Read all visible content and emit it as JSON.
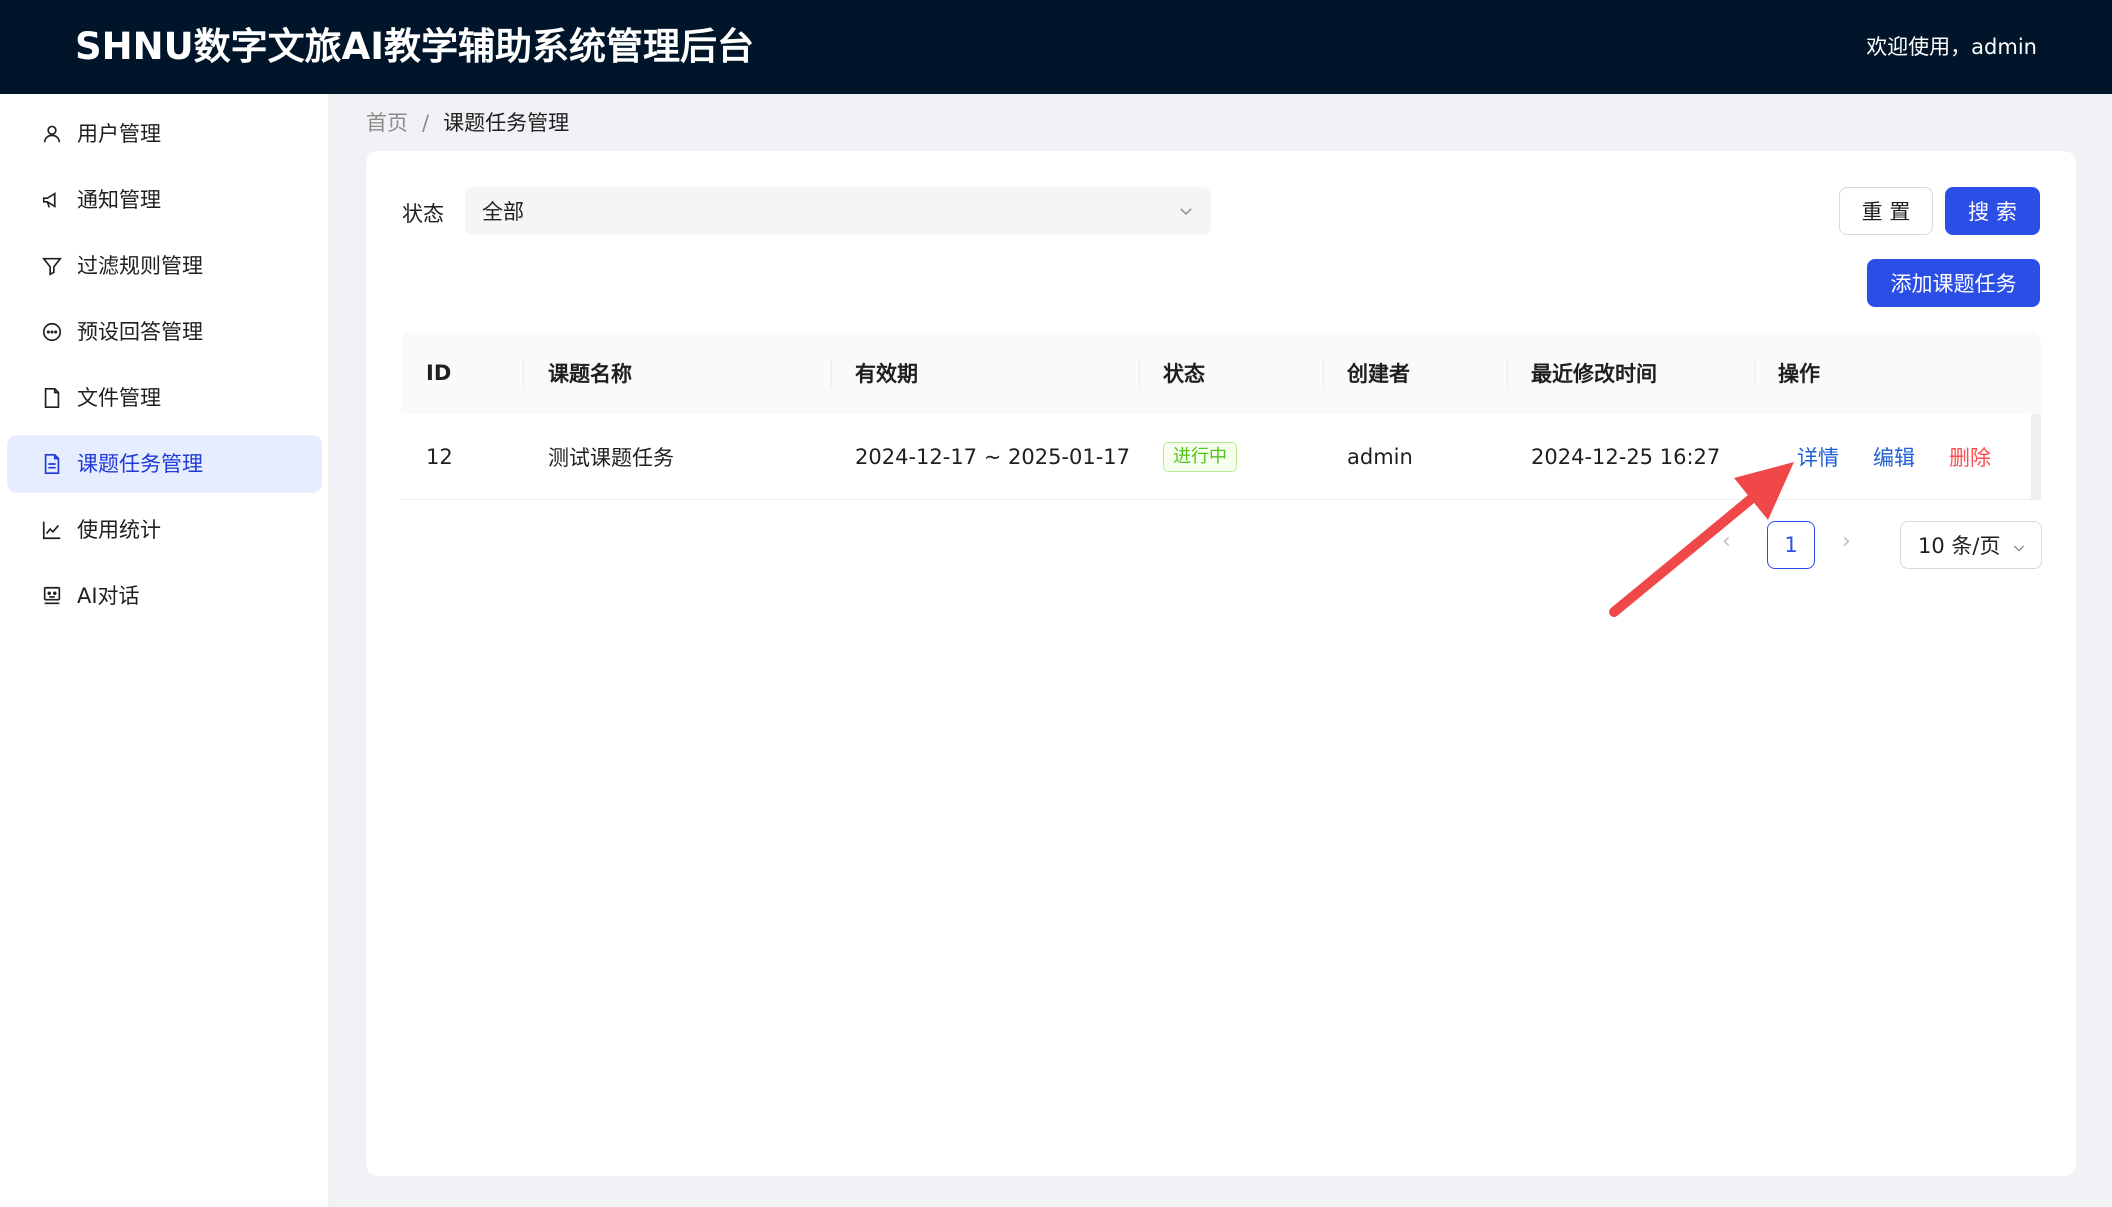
{
  "header": {
    "title": "SHNU数字文旅AI教学辅助系统管理后台",
    "welcome": "欢迎使用，admin"
  },
  "sidebar": {
    "items": [
      {
        "label": "用户管理",
        "icon": "user-icon"
      },
      {
        "label": "通知管理",
        "icon": "megaphone-icon"
      },
      {
        "label": "过滤规则管理",
        "icon": "filter-icon"
      },
      {
        "label": "预设回答管理",
        "icon": "chat-bubble-icon"
      },
      {
        "label": "文件管理",
        "icon": "file-icon"
      },
      {
        "label": "课题任务管理",
        "icon": "file-text-icon",
        "active": true
      },
      {
        "label": "使用统计",
        "icon": "line-chart-icon"
      },
      {
        "label": "AI对话",
        "icon": "robot-icon"
      }
    ]
  },
  "breadcrumb": {
    "home": "首页",
    "separator": "/",
    "current": "课题任务管理"
  },
  "filter": {
    "status_label": "状态",
    "status_value": "全部",
    "reset_label": "重 置",
    "search_label": "搜 索"
  },
  "actions": {
    "add_label": "添加课题任务"
  },
  "table": {
    "headers": [
      "ID",
      "课题名称",
      "有效期",
      "状态",
      "创建者",
      "最近修改时间",
      "操作"
    ],
    "rows": [
      {
        "id": "12",
        "name": "测试课题任务",
        "period": "2024-12-17 ~ 2025-01-17",
        "status": "进行中",
        "creator": "admin",
        "modified": "2024-12-25 16:27",
        "ops": {
          "detail": "详情",
          "edit": "编辑",
          "delete": "删除"
        }
      }
    ]
  },
  "pagination": {
    "current_page": "1",
    "page_size": "10 条/页",
    "prev": "‹",
    "next": "›"
  },
  "colors": {
    "header_bg": "#001529",
    "primary": "#2b4ee6",
    "active_menu_bg": "#e6edff",
    "annotation_arrow": "#f04848"
  }
}
